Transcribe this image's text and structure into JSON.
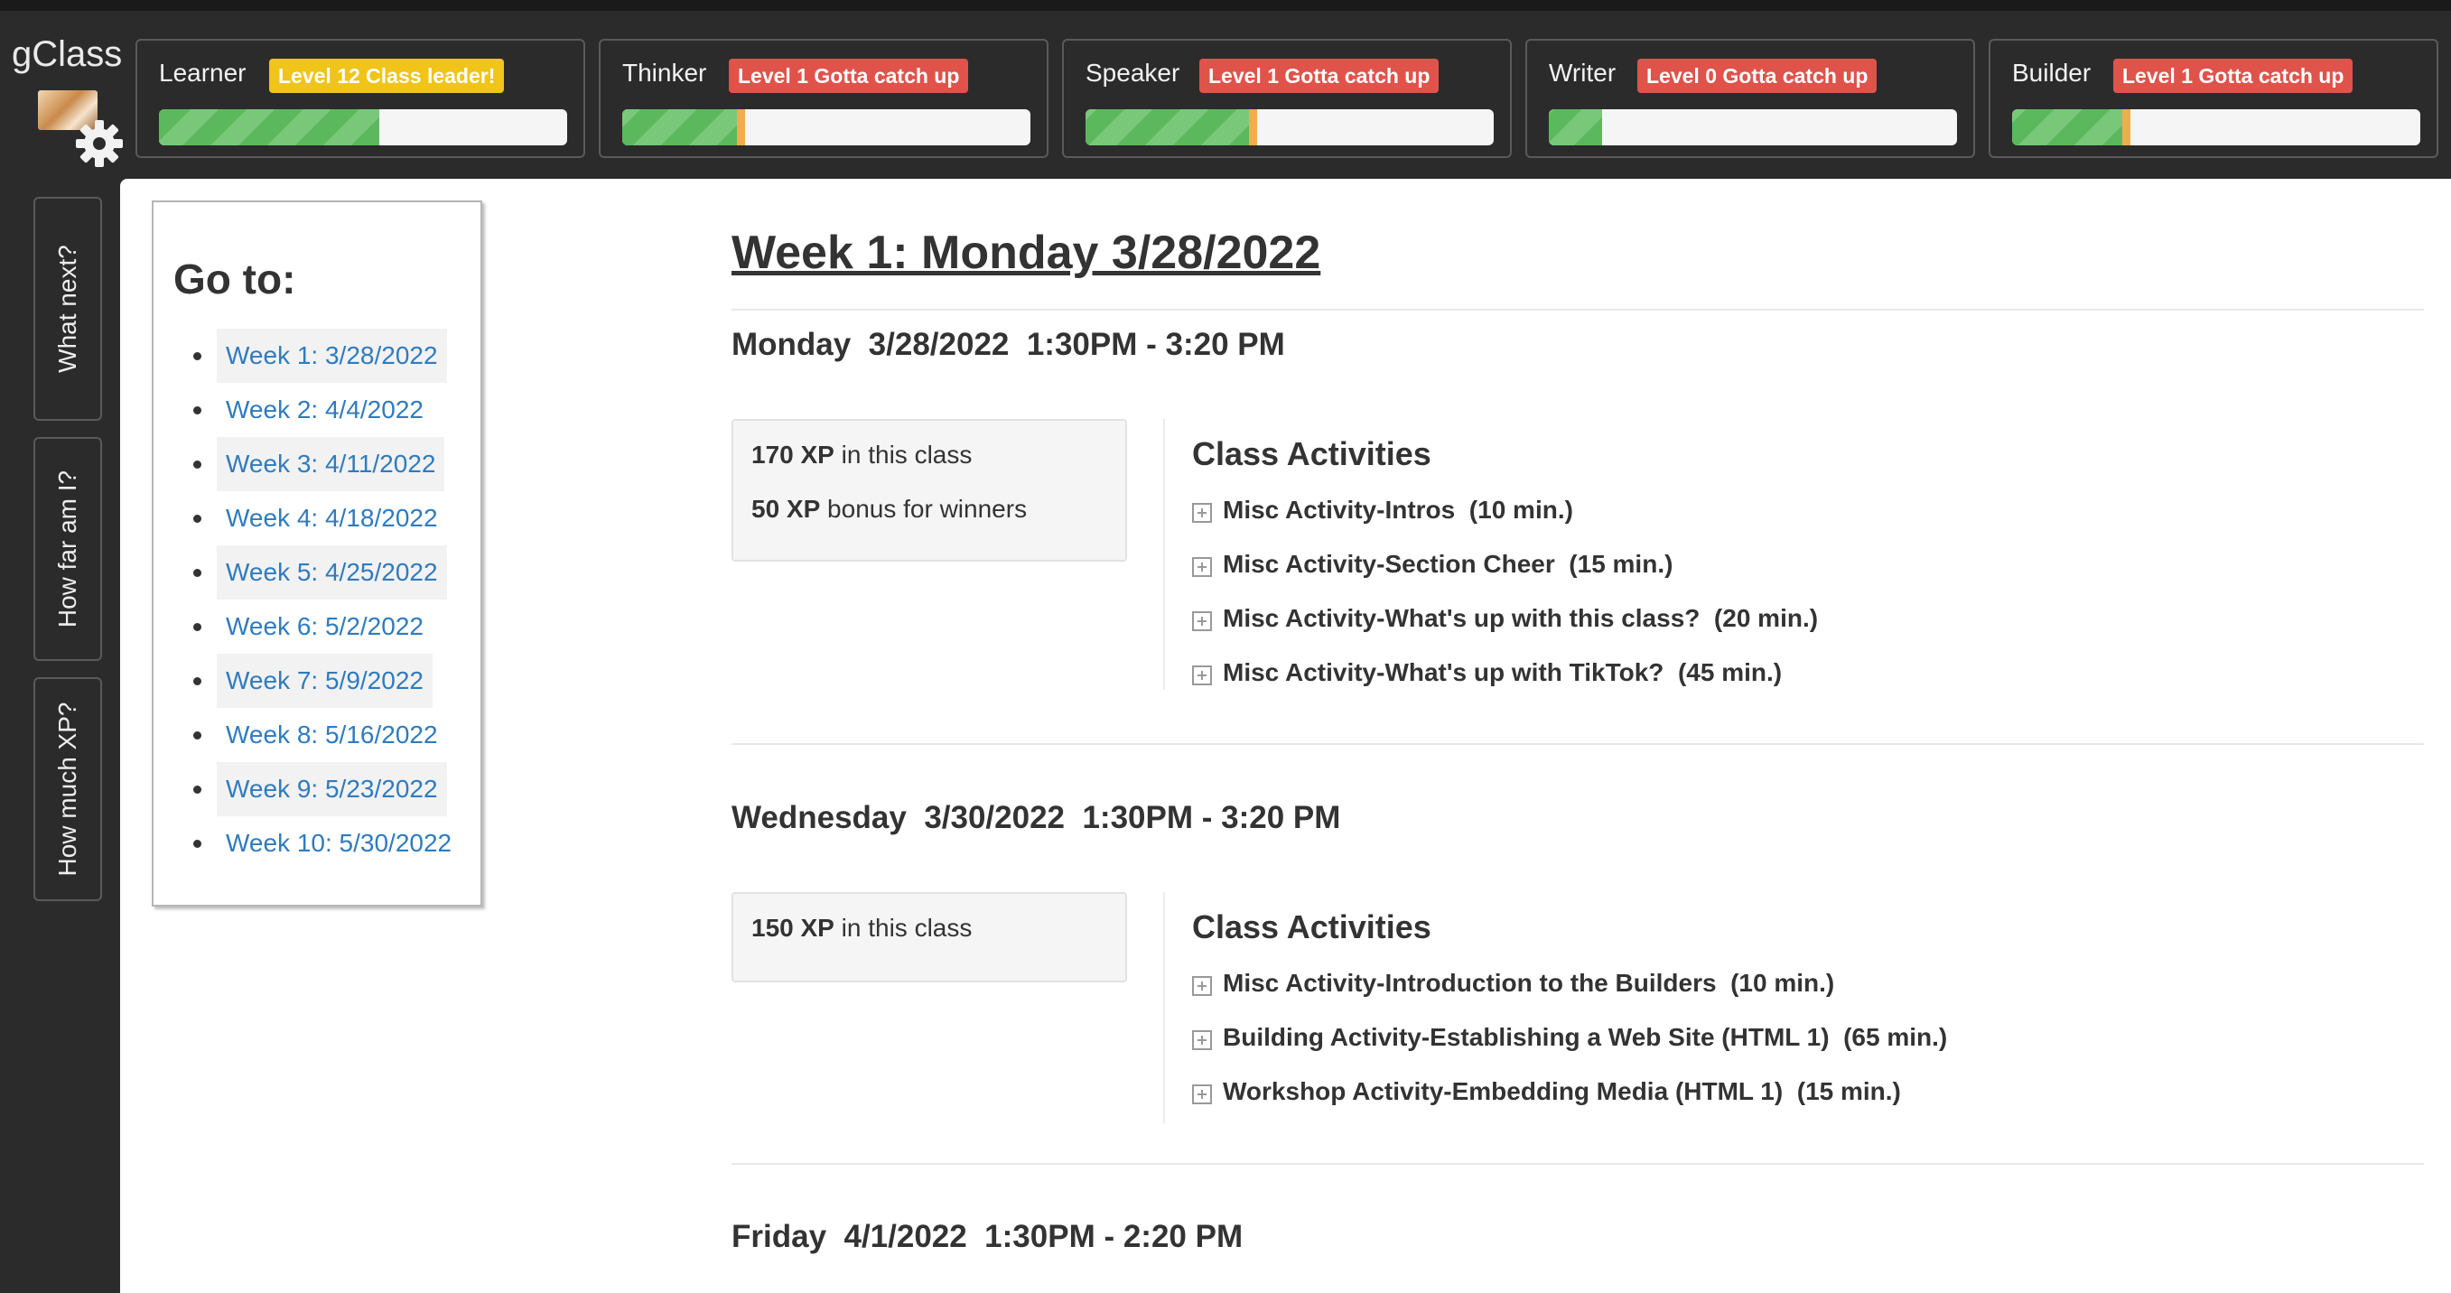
{
  "app": {
    "title": "gClass"
  },
  "skills": [
    {
      "name": "Learner",
      "badge": "Level 12  Class leader!",
      "badge_color": "#f0c419",
      "progress": 0.54,
      "marker": false
    },
    {
      "name": "Thinker",
      "badge": "Level 1  Gotta catch up",
      "badge_color": "#e0534a",
      "progress": 0.3,
      "marker": true
    },
    {
      "name": "Speaker",
      "badge": "Level 1  Gotta catch up",
      "badge_color": "#e0534a",
      "progress": 0.42,
      "marker": true
    },
    {
      "name": "Writer",
      "badge": "Level 0  Gotta catch up",
      "badge_color": "#e0534a",
      "progress": 0.13,
      "marker": false
    },
    {
      "name": "Builder",
      "badge": "Level 1  Gotta catch up",
      "badge_color": "#e0534a",
      "progress": 0.29,
      "marker": true
    }
  ],
  "side_tabs": [
    "What next?",
    "How far am I?",
    "How much XP?"
  ],
  "goto": {
    "title": "Go to:",
    "links": [
      "Week 1: 3/28/2022",
      "Week 2: 4/4/2022",
      "Week 3: 4/11/2022",
      "Week 4: 4/18/2022",
      "Week 5: 4/25/2022",
      "Week 6: 5/2/2022",
      "Week 7: 5/9/2022",
      "Week 8: 5/16/2022",
      "Week 9: 5/23/2022",
      "Week 10: 5/30/2022"
    ]
  },
  "week": {
    "title": "Week 1: Monday 3/28/2022",
    "days": [
      {
        "heading": "Monday  3/28/2022  1:30PM - 3:20 PM",
        "xp": [
          {
            "bold": "170 XP",
            "rest": " in this class"
          },
          {
            "bold": "50 XP",
            "rest": " bonus for winners"
          }
        ],
        "activities_title": "Class Activities",
        "activities": [
          "Misc Activity-Intros  (10 min.)",
          "Misc Activity-Section Cheer  (15 min.)",
          "Misc Activity-What's up with this class?  (20 min.)",
          "Misc Activity-What's up with TikTok?  (45 min.)"
        ]
      },
      {
        "heading": "Wednesday  3/30/2022  1:30PM - 3:20 PM",
        "xp": [
          {
            "bold": "150 XP",
            "rest": " in this class"
          }
        ],
        "activities_title": "Class Activities",
        "activities": [
          "Misc Activity-Introduction to the Builders  (10 min.)",
          "Building Activity-Establishing a Web Site (HTML 1)  (65 min.)",
          "Workshop Activity-Embedding Media (HTML 1)  (15 min.)"
        ]
      },
      {
        "heading": "Friday  4/1/2022  1:30PM - 2:20 PM"
      }
    ]
  }
}
